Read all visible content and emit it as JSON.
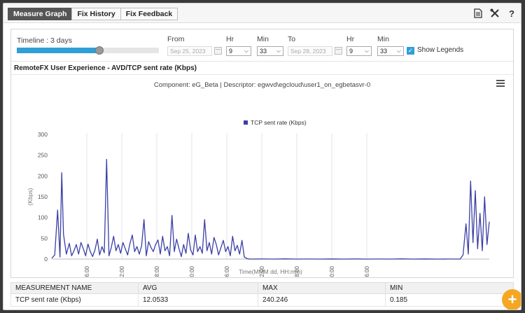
{
  "tabs": [
    "Measure Graph",
    "Fix History",
    "Fix Feedback"
  ],
  "toolbar_icons": [
    "document-icon",
    "tools-icon",
    "help-icon"
  ],
  "controls": {
    "timeline_label": "Timeline : 3 days",
    "timeline_fraction": 0.58,
    "from_label": "From",
    "from_date": "Sep 25, 2023",
    "hr_label": "Hr",
    "min_label": "Min",
    "from_hr": "9",
    "from_min": "33",
    "to_label": "To",
    "to_date": "Sep 28, 2023",
    "to_hr": "9",
    "to_min": "33",
    "show_legends_label": "Show Legends",
    "show_legends_checked": true
  },
  "chart_panel_title": "RemoteFX User Experience - AVD/TCP sent rate (Kbps)",
  "chart_data": {
    "type": "line",
    "title": "Component: eG_Beta | Descriptor: egwvd\\egcloud\\user1_on_egbetasvr-0",
    "xlabel": "Time(MMM dd, HH:mm)",
    "ylabel": "(Kbps)",
    "ylim": [
      0,
      300
    ],
    "yticks": [
      0,
      50,
      100,
      150,
      200,
      250,
      300
    ],
    "xlim_hours": [
      0,
      75
    ],
    "xtick_labels": [
      "Sep 26 06:00",
      "Sep 26 12:00",
      "Sep 26 18:00",
      "Sep 27 00:00",
      "Sep 27 06:00",
      "Sep 27 12:00",
      "Sep 27 18:00",
      "Sep 28 00:00",
      "Sep 28 06:00"
    ],
    "legend": "top-center",
    "series": [
      {
        "name": "TCP sent rate (Kbps)",
        "color": "#3b3fa5",
        "x_hours": [
          0,
          0.5,
          1,
          1.4,
          1.7,
          2,
          2.5,
          3,
          3.4,
          3.8,
          4.2,
          4.6,
          5,
          5.4,
          5.8,
          6.2,
          6.6,
          7,
          7.4,
          7.8,
          8.2,
          8.6,
          9,
          9.4,
          9.8,
          10.2,
          10.6,
          11,
          11.4,
          11.8,
          12.2,
          12.6,
          13,
          13.4,
          13.8,
          14.2,
          14.6,
          15,
          15.4,
          15.8,
          16.2,
          16.6,
          17,
          17.4,
          17.8,
          18.2,
          18.6,
          19,
          19.4,
          19.8,
          20.2,
          20.6,
          21,
          21.4,
          21.8,
          22.2,
          22.6,
          23,
          23.4,
          23.8,
          24.2,
          24.6,
          25,
          25.4,
          25.8,
          26.2,
          26.6,
          27,
          27.4,
          27.8,
          28.2,
          28.6,
          29,
          29.4,
          29.8,
          30.2,
          30.6,
          31,
          31.4,
          31.8,
          32.2,
          32.6,
          33,
          33.5,
          34,
          36,
          38,
          40,
          42,
          44,
          46,
          48,
          50,
          52,
          54,
          56,
          58,
          60,
          62,
          64,
          66,
          68,
          70,
          70.5,
          71,
          71.4,
          71.8,
          72.2,
          72.6,
          73,
          73.4,
          73.8,
          74.2,
          74.6,
          75
        ],
        "values": [
          2,
          10,
          118,
          5,
          208,
          60,
          12,
          38,
          8,
          20,
          35,
          12,
          40,
          25,
          8,
          36,
          18,
          6,
          22,
          48,
          10,
          30,
          15,
          240,
          8,
          28,
          55,
          20,
          35,
          14,
          40,
          25,
          10,
          38,
          58,
          18,
          30,
          12,
          32,
          95,
          8,
          42,
          28,
          18,
          35,
          46,
          12,
          55,
          20,
          30,
          8,
          105,
          18,
          48,
          25,
          6,
          35,
          14,
          62,
          22,
          10,
          58,
          18,
          30,
          14,
          95,
          20,
          40,
          12,
          52,
          35,
          10,
          28,
          45,
          18,
          30,
          8,
          55,
          20,
          33,
          12,
          45,
          5,
          1,
          0,
          0.3,
          0,
          0.5,
          0,
          0.2,
          0,
          0.4,
          0,
          0.3,
          0,
          0.2,
          0,
          0.5,
          0,
          0.3,
          0,
          0.2,
          0,
          10,
          85,
          12,
          188,
          40,
          165,
          25,
          110,
          20,
          150,
          35,
          90,
          10
        ]
      }
    ]
  },
  "table": {
    "headers": [
      "MEASUREMENT NAME",
      "AVG",
      "MAX",
      "MIN"
    ],
    "rows": [
      [
        "TCP sent rate (Kbps)",
        "12.0533",
        "240.246",
        "0.185"
      ]
    ]
  }
}
